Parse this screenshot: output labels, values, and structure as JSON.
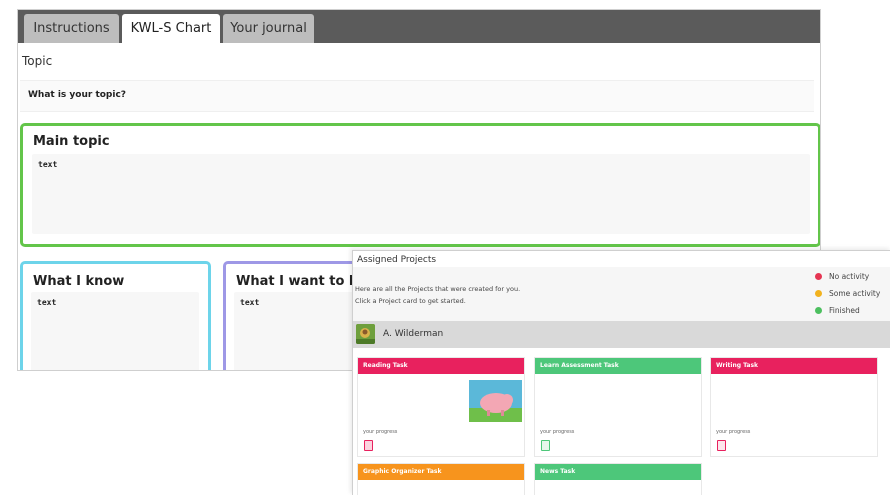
{
  "kwl": {
    "tabs": [
      {
        "label": "Instructions",
        "active": false
      },
      {
        "label": "KWL-S Chart",
        "active": true
      },
      {
        "label": "Your journal",
        "active": false
      }
    ],
    "topic": {
      "label": "Topic",
      "question": "What is your topic?"
    },
    "main_topic": {
      "title": "Main topic",
      "text": "text",
      "border_color": "#63c54a"
    },
    "know": {
      "title": "What I know",
      "text": "text",
      "border_color": "#6dd4ea"
    },
    "want": {
      "title": "What I want to know",
      "text": "text",
      "border_color": "#9e98e6"
    }
  },
  "projects": {
    "title": "Assigned Projects",
    "description_line1": "Here are all the Projects that were created for you.",
    "description_line2": "Click a Project card to get started.",
    "legend": [
      {
        "label": "No activity",
        "color": "#e53552"
      },
      {
        "label": "Some activity",
        "color": "#f2b21e"
      },
      {
        "label": "Finished",
        "color": "#4cbf5f"
      }
    ],
    "user": {
      "name": "A. Wilderman"
    },
    "progress_label": "your progress",
    "tasks": [
      {
        "label": "Reading Task",
        "color": "#e8215e",
        "icon_color": "#e8215e"
      },
      {
        "label": "Learn Assessment Task",
        "color": "#4dc77a",
        "icon_color": "#4dc77a"
      },
      {
        "label": "Writing Task",
        "color": "#e8215e",
        "icon_color": "#e8215e"
      },
      {
        "label": "Graphic Organizer Task",
        "color": "#f7941d"
      },
      {
        "label": "News Task",
        "color": "#4dc77a"
      }
    ]
  }
}
